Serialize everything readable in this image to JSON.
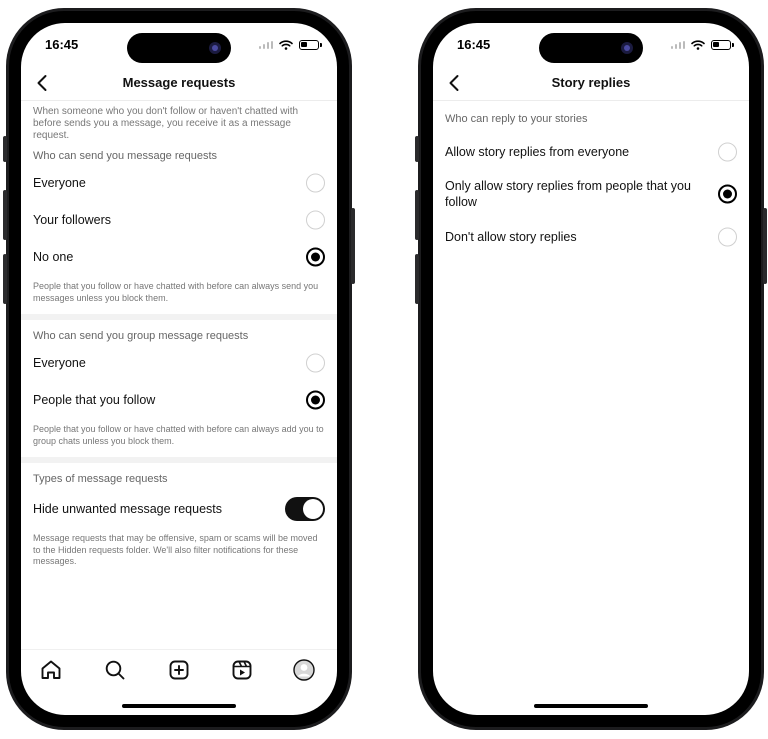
{
  "left_phone": {
    "status": {
      "time": "16:45"
    },
    "header": {
      "title": "Message requests"
    },
    "intro": "When someone who you don't follow or haven't chatted with before sends you a message, you receive it as a message request.",
    "sections": [
      {
        "header": "Who can send you message requests",
        "options": [
          {
            "label": "Everyone",
            "selected": false
          },
          {
            "label": "Your followers",
            "selected": false
          },
          {
            "label": "No one",
            "selected": true
          }
        ],
        "footnote": "People that you follow or have chatted with before can always send you messages unless you block them."
      },
      {
        "header": "Who can send you group message requests",
        "options": [
          {
            "label": "Everyone",
            "selected": false
          },
          {
            "label": "People that you follow",
            "selected": true
          }
        ],
        "footnote": "People that you follow or have chatted with before can always add you to group chats unless you block them."
      }
    ],
    "types_section": {
      "header": "Types of message requests",
      "toggle_label": "Hide unwanted message requests",
      "toggle_on": true,
      "footnote": "Message requests that may be offensive, spam or scams will be moved to the Hidden requests folder. We'll also filter notifications for these messages."
    },
    "bottom_nav": [
      "home-icon",
      "search-icon",
      "create-icon",
      "reels-icon",
      "profile-icon"
    ]
  },
  "right_phone": {
    "status": {
      "time": "16:45"
    },
    "header": {
      "title": "Story replies"
    },
    "section_header": "Who can reply to your stories",
    "options": [
      {
        "label": "Allow story replies from everyone",
        "selected": false
      },
      {
        "label": "Only allow story replies from people that you follow",
        "selected": true
      },
      {
        "label": "Don't allow story replies",
        "selected": false
      }
    ]
  },
  "colors": {
    "selected": "#000000",
    "toggle_on": "#111111",
    "secondary_text": "#777777"
  }
}
